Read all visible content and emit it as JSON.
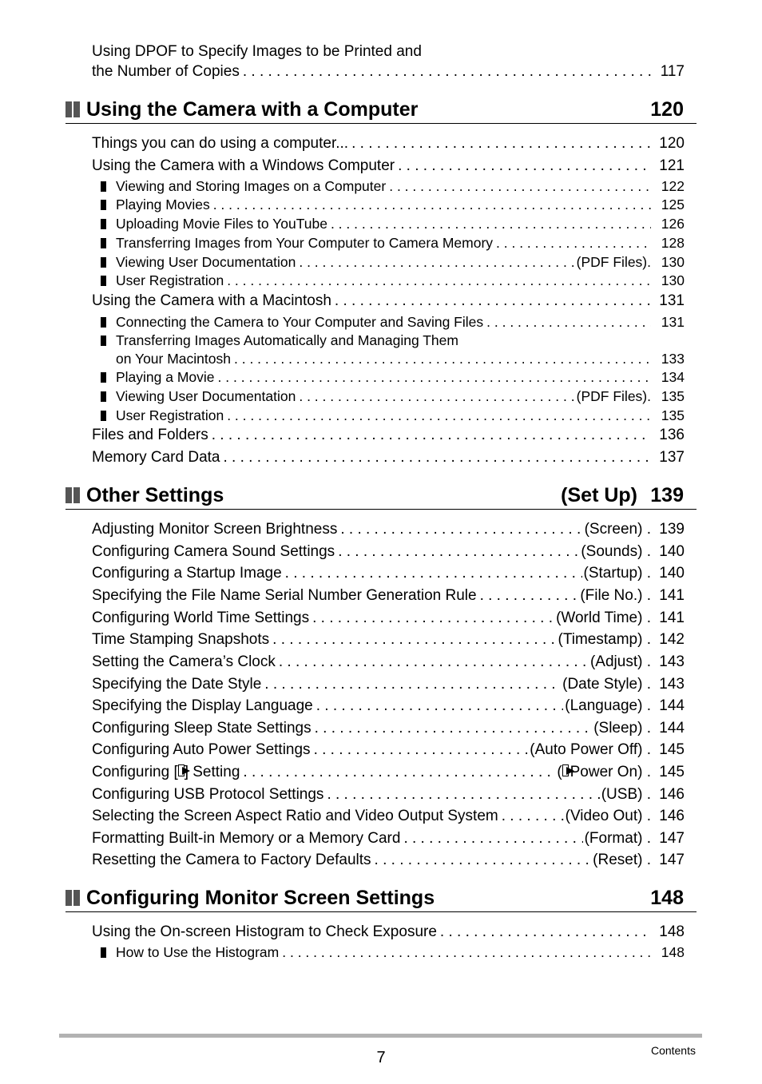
{
  "intro": {
    "line1": "Using DPOF to Specify Images to be Printed and",
    "line2": "the Number of Copies",
    "page": "117"
  },
  "sections": [
    {
      "title": "Using the Camera with a Computer",
      "suffix": "",
      "page": "120",
      "entries": [
        {
          "title": "Things you can do using a computer...",
          "suffix": "",
          "page": "120",
          "level": 1
        },
        {
          "title": "Using the Camera with a Windows Computer",
          "suffix": "",
          "page": "121",
          "level": 1
        },
        {
          "title": "Viewing and Storing Images on a Computer",
          "suffix": "",
          "page": "122",
          "level": 2
        },
        {
          "title": "Playing Movies",
          "suffix": "",
          "page": "125",
          "level": 2
        },
        {
          "title": "Uploading Movie Files to YouTube",
          "suffix": "",
          "page": "126",
          "level": 2
        },
        {
          "title": "Transferring Images from Your Computer to Camera Memory",
          "suffix": "",
          "page": "128",
          "level": 2
        },
        {
          "title": "Viewing User Documentation",
          "suffix": "(PDF Files).",
          "page": "130",
          "level": 2
        },
        {
          "title": "User Registration",
          "suffix": "",
          "page": "130",
          "level": 2
        },
        {
          "title": "Using the Camera with a Macintosh",
          "suffix": "",
          "page": "131",
          "level": 1
        },
        {
          "title": "Connecting the Camera to Your Computer and Saving Files",
          "suffix": "",
          "page": "131",
          "level": 2
        },
        {
          "title": "Transferring Images Automatically and Managing Them",
          "continuation": "on Your Macintosh",
          "suffix": "",
          "page": "133",
          "level": 2
        },
        {
          "title": "Playing a Movie",
          "suffix": "",
          "page": "134",
          "level": 2
        },
        {
          "title": "Viewing User Documentation",
          "suffix": "(PDF Files).",
          "page": "135",
          "level": 2
        },
        {
          "title": "User Registration",
          "suffix": "",
          "page": "135",
          "level": 2
        },
        {
          "title": "Files and Folders",
          "suffix": "",
          "page": "136",
          "level": 1
        },
        {
          "title": "Memory Card Data",
          "suffix": "",
          "page": "137",
          "level": 1
        }
      ]
    },
    {
      "title": "Other Settings",
      "suffix": "(Set Up)",
      "page": "139",
      "entries": [
        {
          "title": "Adjusting Monitor Screen Brightness",
          "suffix": "(Screen) .",
          "page": "139",
          "level": 1
        },
        {
          "title": "Configuring Camera Sound Settings",
          "suffix": "(Sounds) .",
          "page": "140",
          "level": 1
        },
        {
          "title": "Configuring a Startup Image",
          "suffix": "(Startup) .",
          "page": "140",
          "level": 1
        },
        {
          "title": "Specifying the File Name Serial Number Generation Rule",
          "suffix": "(File No.) .",
          "page": "141",
          "level": 1
        },
        {
          "title": "Configuring World Time Settings",
          "suffix": "(World Time) .",
          "page": "141",
          "level": 1
        },
        {
          "title": "Time Stamping Snapshots",
          "suffix": "(Timestamp) .",
          "page": "142",
          "level": 1
        },
        {
          "title": "Setting the Camera’s Clock",
          "suffix": "(Adjust) .",
          "page": "143",
          "level": 1
        },
        {
          "title": "Specifying the Date Style",
          "suffix": "(Date Style) .",
          "page": "143",
          "level": 1
        },
        {
          "title": "Specifying the Display Language",
          "suffix": "(Language) .",
          "page": "144",
          "level": 1
        },
        {
          "title": "Configuring Sleep State Settings",
          "suffix": "(Sleep) .",
          "page": "144",
          "level": 1
        },
        {
          "title": "Configuring Auto Power Settings",
          "suffix": "(Auto Power Off) .",
          "page": "145",
          "level": 1
        },
        {
          "title": "Configuring [",
          "title_icon": "play-icon",
          "title_after": "] Setting",
          "suffix": "(",
          "suffix_icon": "play-icon",
          "suffix_after": " Power On) .",
          "page": "145",
          "level": 1
        },
        {
          "title": "Configuring USB Protocol Settings",
          "suffix": "(USB) .",
          "page": "146",
          "level": 1
        },
        {
          "title": "Selecting the Screen Aspect Ratio and Video Output System",
          "suffix": "(Video Out) .",
          "page": "146",
          "level": 1
        },
        {
          "title": "Formatting Built-in Memory or a Memory Card",
          "suffix": "(Format) .",
          "page": "147",
          "level": 1
        },
        {
          "title": "Resetting the Camera to Factory Defaults",
          "suffix": "(Reset) .",
          "page": "147",
          "level": 1
        }
      ]
    },
    {
      "title": "Configuring Monitor Screen Settings",
      "suffix": "",
      "page": "148",
      "entries": [
        {
          "title": "Using the On-screen Histogram to Check Exposure",
          "suffix": "",
          "page": "148",
          "level": 1
        },
        {
          "title": "How to Use the Histogram",
          "suffix": "",
          "page": "148",
          "level": 2
        }
      ]
    }
  ],
  "footer": {
    "page_number": "7",
    "label": "Contents"
  }
}
